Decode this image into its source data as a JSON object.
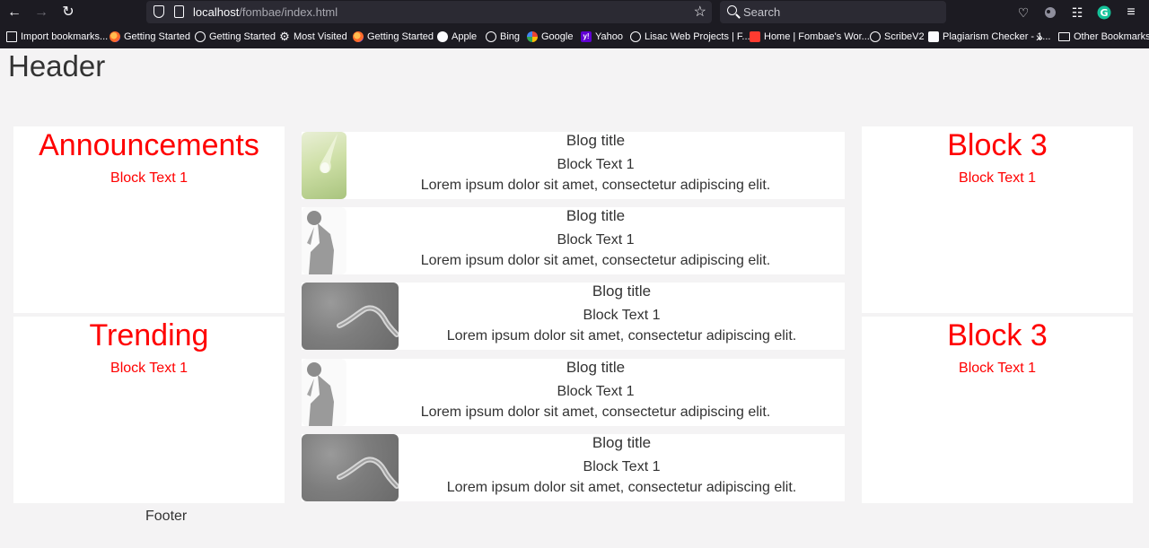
{
  "browser": {
    "url_host": "localhost",
    "url_path": "/fombae/index.html",
    "search_placeholder": "Search"
  },
  "bookmarks": [
    {
      "label": "Import bookmarks...",
      "icon": "import-icon"
    },
    {
      "label": "Getting Started",
      "icon": "firefox-icon"
    },
    {
      "label": "Getting Started",
      "icon": "globe-icon"
    },
    {
      "label": "Most Visited",
      "icon": "gear-icon"
    },
    {
      "label": "Getting Started",
      "icon": "firefox-icon"
    },
    {
      "label": "Apple",
      "icon": "apple-icon"
    },
    {
      "label": "Bing",
      "icon": "globe-icon"
    },
    {
      "label": "Google",
      "icon": "google-icon"
    },
    {
      "label": "Yahoo",
      "icon": "yahoo-icon"
    },
    {
      "label": "Lisac Web Projects | F...",
      "icon": "globe-icon"
    },
    {
      "label": "Home | Fombae's Wor...",
      "icon": "site-icon"
    },
    {
      "label": "ScribeV2",
      "icon": "globe-icon"
    },
    {
      "label": "Plagiarism Checker - 1...",
      "icon": "sst-icon"
    },
    {
      "label": "Other Bookmarks",
      "icon": "folder-icon"
    }
  ],
  "page": {
    "header": "Header",
    "footer": "Footer",
    "left_blocks": [
      {
        "title": "Announcements",
        "text": "Block Text 1"
      },
      {
        "title": "Trending",
        "text": "Block Text 1"
      }
    ],
    "right_blocks": [
      {
        "title": "Block 3",
        "text": "Block Text 1"
      },
      {
        "title": "Block 3",
        "text": "Block Text 1"
      }
    ],
    "blog_cards": [
      {
        "title": "Blog title",
        "subtitle": "Block Text 1",
        "body": "Lorem ipsum dolor sit amet, consectetur adipiscing elit.",
        "image": "water-drop"
      },
      {
        "title": "Blog title",
        "subtitle": "Block Text 1",
        "body": "Lorem ipsum dolor sit amet, consectetur adipiscing elit.",
        "image": "person-silhouette"
      },
      {
        "title": "Blog title",
        "subtitle": "Block Text 1",
        "body": "Lorem ipsum dolor sit amet, consectetur adipiscing elit.",
        "image": "snake"
      },
      {
        "title": "Blog title",
        "subtitle": "Block Text 1",
        "body": "Lorem ipsum dolor sit amet, consectetur adipiscing elit.",
        "image": "person-silhouette"
      },
      {
        "title": "Blog title",
        "subtitle": "Block Text 1",
        "body": "Lorem ipsum dolor sit amet, consectetur adipiscing elit.",
        "image": "snake"
      }
    ]
  },
  "colors": {
    "accent_red": "#ff0000",
    "chrome_dark": "#1c1b22",
    "page_bg": "#f4f3f4"
  }
}
